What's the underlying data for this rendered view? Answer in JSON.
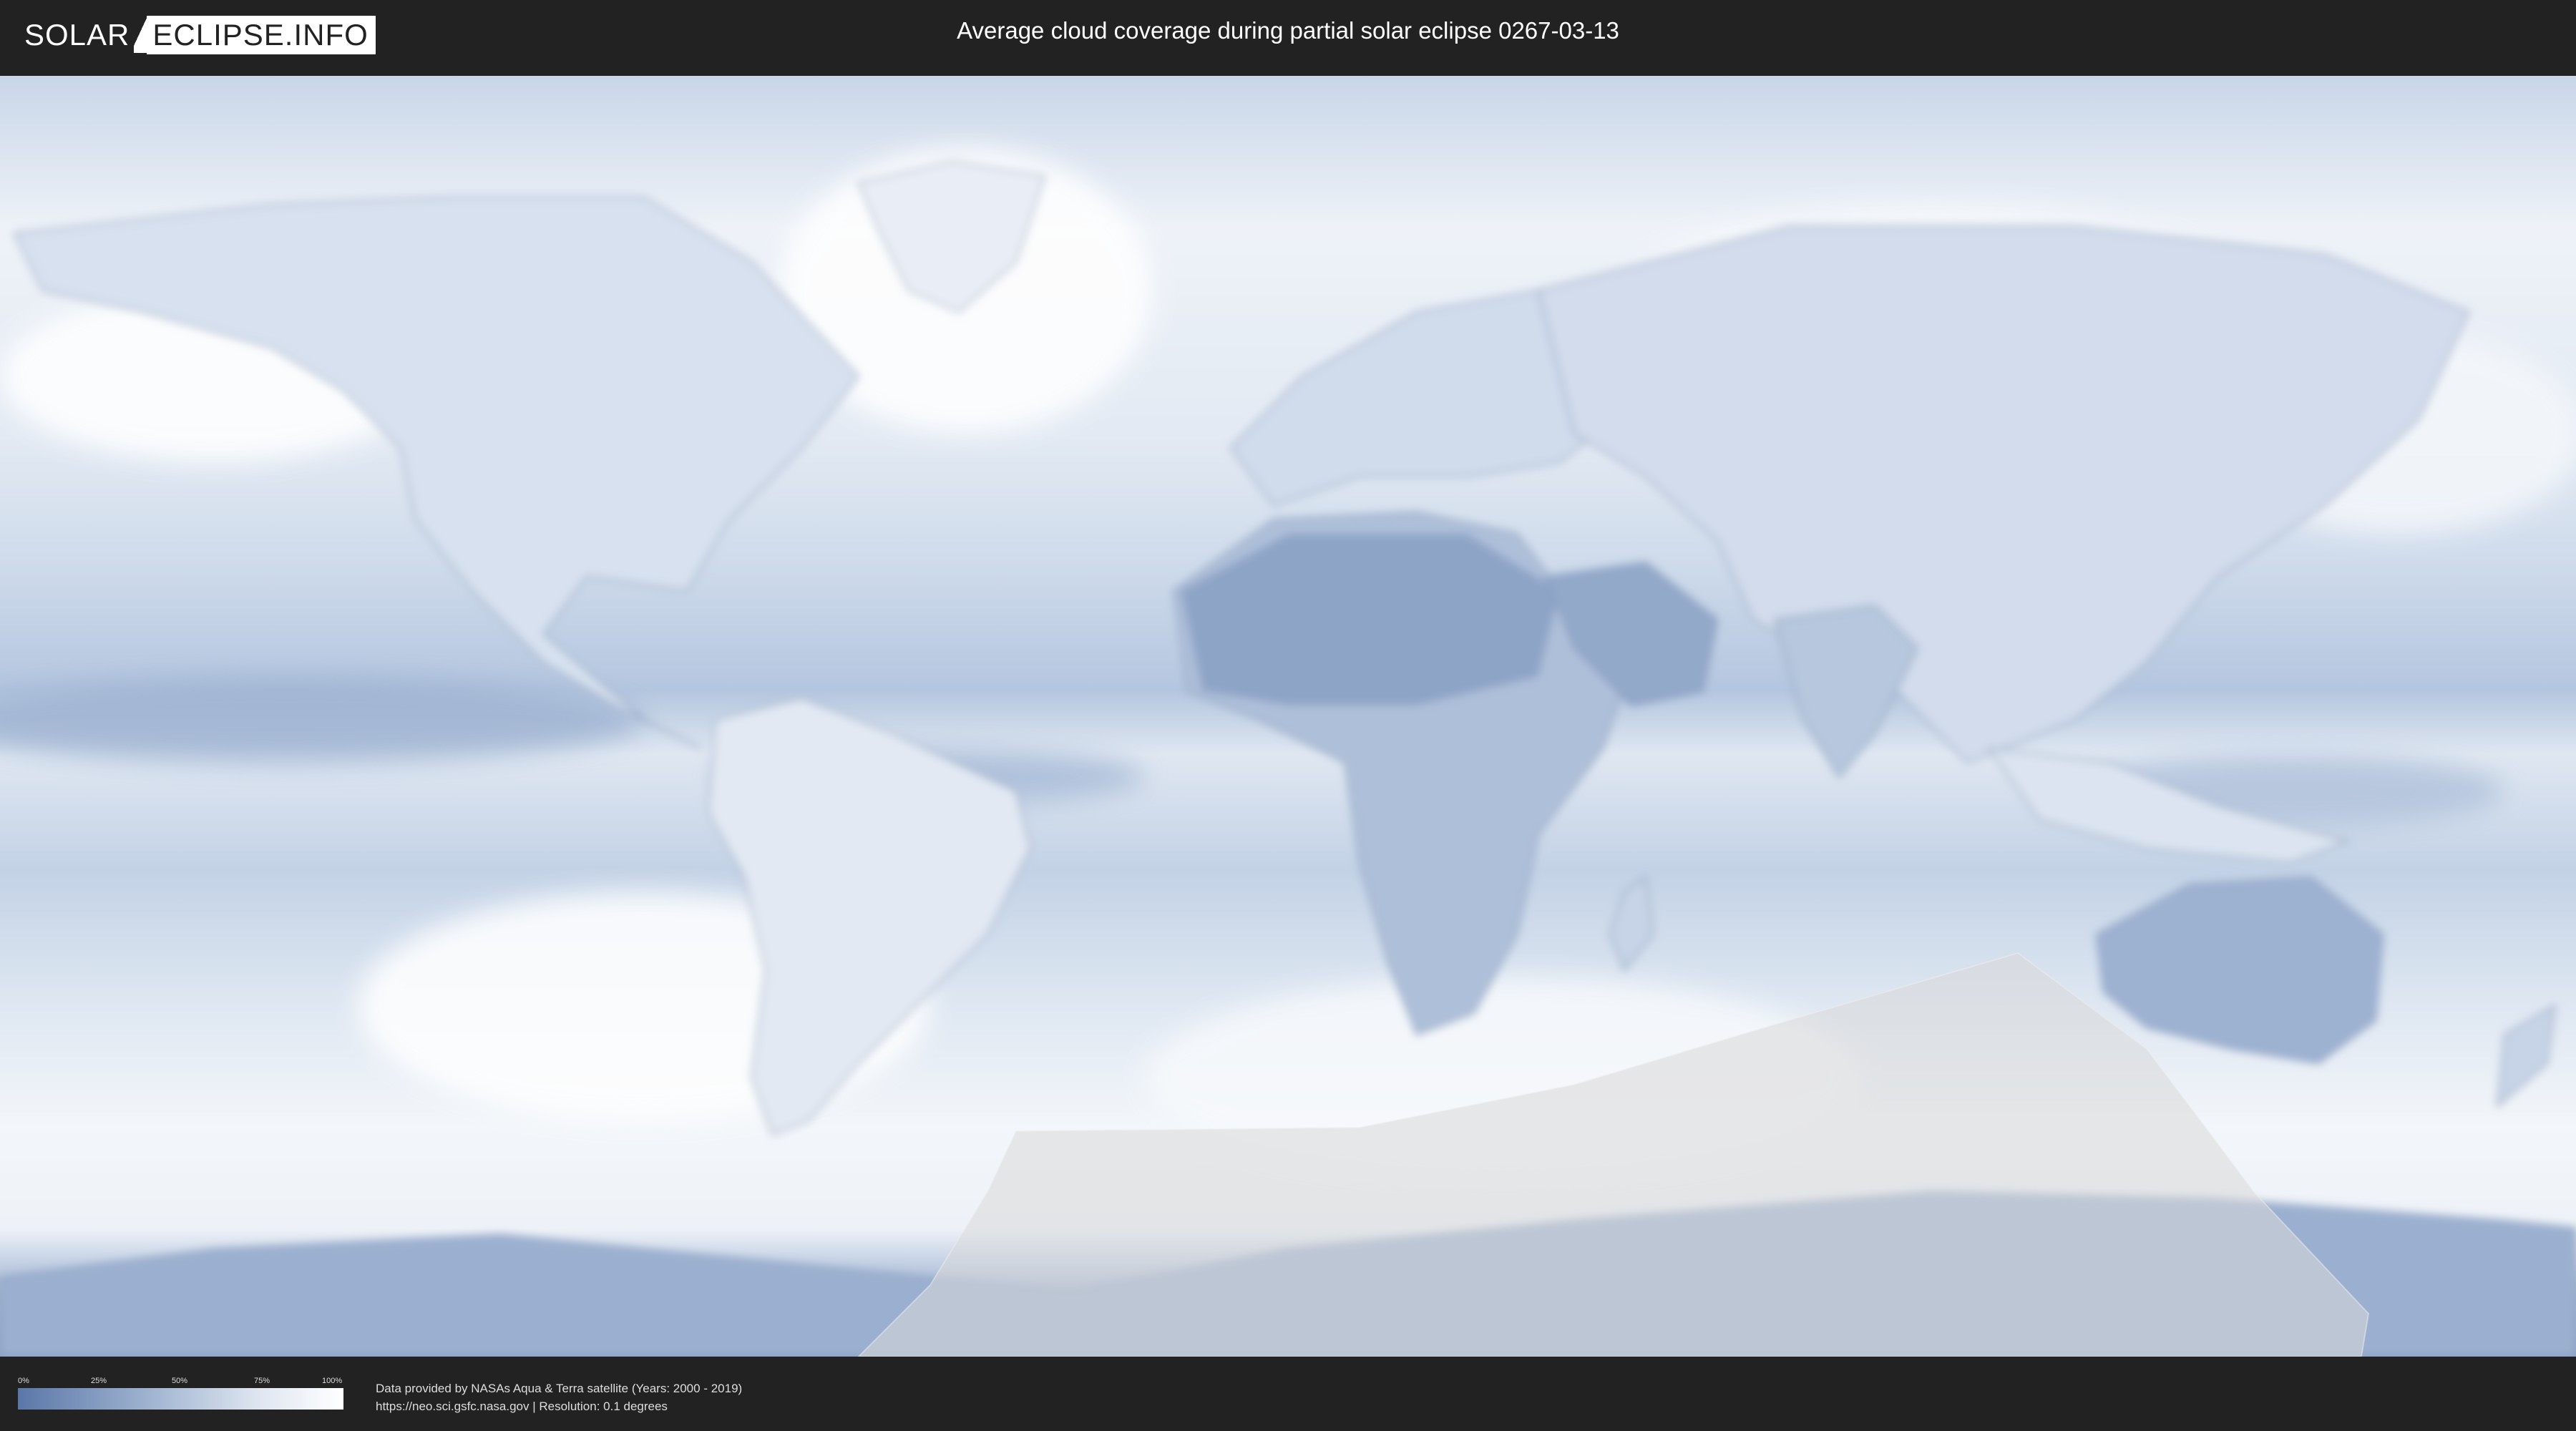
{
  "header": {
    "logo_part1": "SOLAR",
    "logo_part2": "ECLIPSE.INFO",
    "title": "Average cloud coverage during partial solar eclipse 0267-03-13"
  },
  "legend": {
    "ticks": [
      "0%",
      "25%",
      "50%",
      "75%",
      "100%"
    ],
    "gradient_colors": [
      "#5a77a8",
      "#9fb3d0",
      "#e0e7f1",
      "#ffffff"
    ]
  },
  "footer": {
    "credit_line1": "Data provided by NASAs Aqua & Terra satellite (Years: 2000 - 2019)",
    "credit_line2": "https://neo.sci.gsfc.nasa.gov | Resolution: 0.1 degrees"
  },
  "colors": {
    "background": "#222222",
    "ocean_clear": "#6f8fbd",
    "cloud": "#f4f7fb",
    "eclipse_overlay": "#d9d9d9"
  }
}
